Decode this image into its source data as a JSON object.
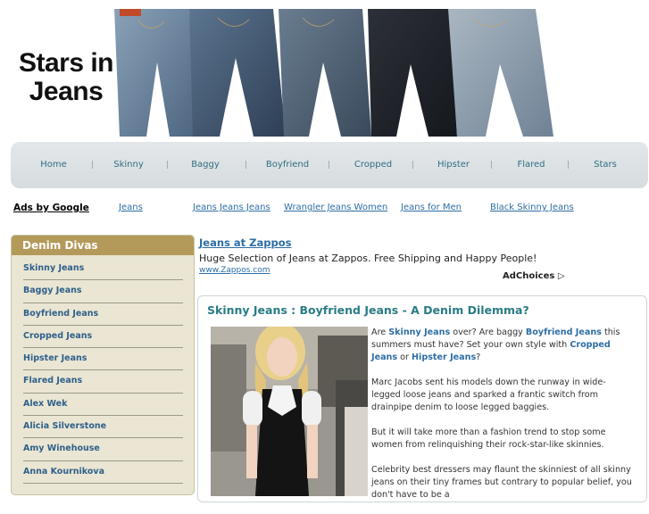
{
  "logo": {
    "line1": "Stars in",
    "line2": "Jeans"
  },
  "nav": {
    "items": [
      "Home",
      "Skinny",
      "Baggy",
      "Boyfriend",
      "Cropped",
      "Hipster",
      "Flared",
      "Stars"
    ]
  },
  "ads_row": {
    "label": "Ads by Google",
    "links": [
      "Jeans",
      "Jeans Jeans Jeans",
      "Wrangler Jeans Women",
      "Jeans for Men",
      "Black Skinny Jeans"
    ]
  },
  "sidebar": {
    "title": "Denim Divas",
    "items": [
      "Skinny Jeans",
      "Baggy Jeans",
      "Boyfriend Jeans",
      "Cropped Jeans",
      "Hipster Jeans",
      "Flared Jeans",
      "Alex Wek",
      "Alicia Silverstone",
      "Amy Winehouse",
      "Anna Kournikova"
    ]
  },
  "ad": {
    "title": "Jeans at Zappos",
    "text": "Huge Selection of Jeans at Zappos. Free Shipping and Happy People!",
    "url": "www.Zappos.com",
    "adchoices": "AdChoices"
  },
  "article": {
    "title": "Skinny Jeans : Boyfriend Jeans - A Denim Dilemma?",
    "p1": {
      "t1": "Are ",
      "k1": "Skinny Jeans",
      "t2": " over? Are baggy ",
      "k2": "Boyfriend Jeans",
      "t3": " this summers must have? Set your own style with ",
      "k3": "Cropped Jeans",
      "t4": " or ",
      "k4": "Hipster Jeans",
      "t5": "?"
    },
    "p2": "Marc Jacobs sent his models down the runway in wide-legged loose jeans and sparked a frantic switch from drainpipe denim to loose legged baggies.",
    "p3": "But it will take more than a fashion trend to stop some women from relinquishing their rock-star-like skinnies.",
    "p4": "Celebrity best dressers may flaunt the skinniest of all skinny jeans on their tiny frames but contrary to popular belief, you don't have to be a"
  },
  "colors": {
    "accent": "#2e6da4",
    "sidebar_header": "#b49a5a",
    "sidebar_bg": "#eae6d3",
    "nav_text": "#2f6e7f",
    "title_teal": "#2a7c86"
  }
}
